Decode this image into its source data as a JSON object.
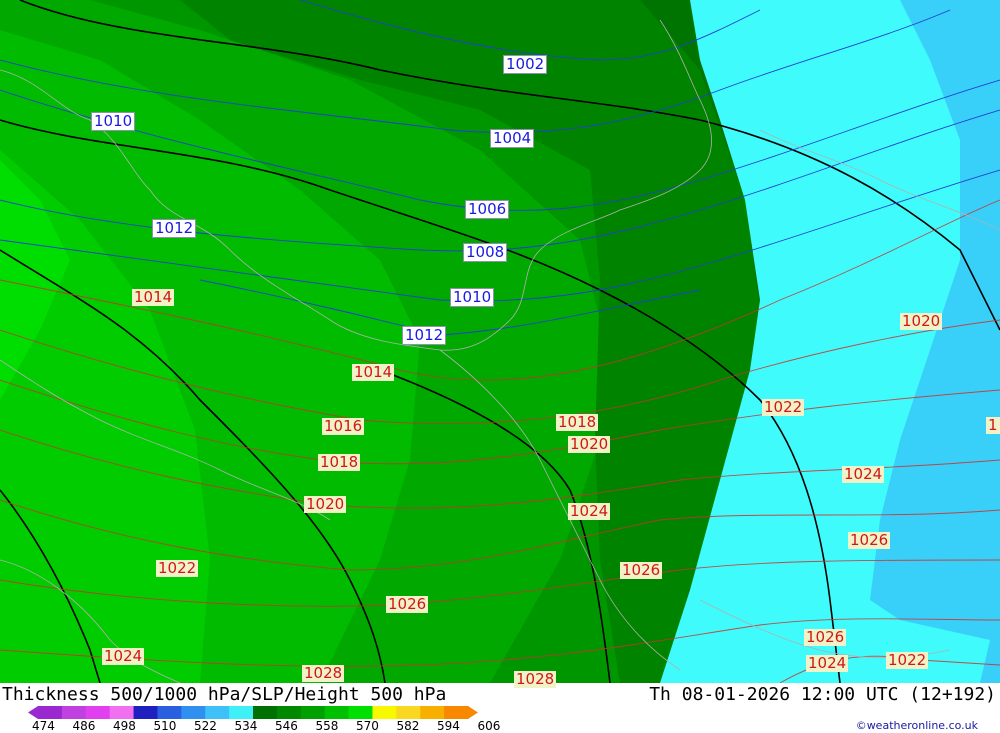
{
  "title": "Thickness 500/1000 hPa/SLP/Height 500 hPa",
  "datetime": "Th 08-01-2026 12:00 UTC (12+192)",
  "credit": "©weatheronline.co.uk",
  "legend": {
    "ticks": [
      "474",
      "486",
      "498",
      "510",
      "522",
      "534",
      "546",
      "558",
      "570",
      "582",
      "594",
      "606"
    ],
    "colors": [
      "#9a2ad0",
      "#c040e0",
      "#e040f0",
      "#f070f0",
      "#2020c0",
      "#2a60e0",
      "#3090f0",
      "#40c0f8",
      "#40f0f8",
      "#007000",
      "#008800",
      "#00a000",
      "#00c000",
      "#00e000",
      "#f8f800",
      "#f8d820",
      "#f8b000",
      "#f88800"
    ]
  },
  "map": {
    "slp_labels": [
      {
        "text": "1014",
        "color": "red"
      },
      {
        "text": "1014",
        "color": "red"
      },
      {
        "text": "1016",
        "color": "red"
      },
      {
        "text": "1018",
        "color": "red"
      },
      {
        "text": "1018",
        "color": "red"
      },
      {
        "text": "1020",
        "color": "red"
      },
      {
        "text": "1020",
        "color": "red"
      },
      {
        "text": "1020",
        "color": "red"
      },
      {
        "text": "1022",
        "color": "red"
      },
      {
        "text": "1022",
        "color": "red"
      },
      {
        "text": "1022",
        "color": "red"
      },
      {
        "text": "1024",
        "color": "red"
      },
      {
        "text": "1024",
        "color": "red"
      },
      {
        "text": "1024",
        "color": "red"
      },
      {
        "text": "1024",
        "color": "red"
      },
      {
        "text": "1026",
        "color": "red"
      },
      {
        "text": "1026",
        "color": "red"
      },
      {
        "text": "1026",
        "color": "red"
      },
      {
        "text": "1026",
        "color": "red"
      },
      {
        "text": "1028",
        "color": "red"
      },
      {
        "text": "1028",
        "color": "red"
      },
      {
        "text": "1",
        "color": "red"
      }
    ],
    "height_labels": [
      {
        "text": "1002"
      },
      {
        "text": "1004"
      },
      {
        "text": "1006"
      },
      {
        "text": "1008"
      },
      {
        "text": "1010"
      },
      {
        "text": "1010"
      },
      {
        "text": "1012"
      },
      {
        "text": "1012"
      }
    ]
  }
}
